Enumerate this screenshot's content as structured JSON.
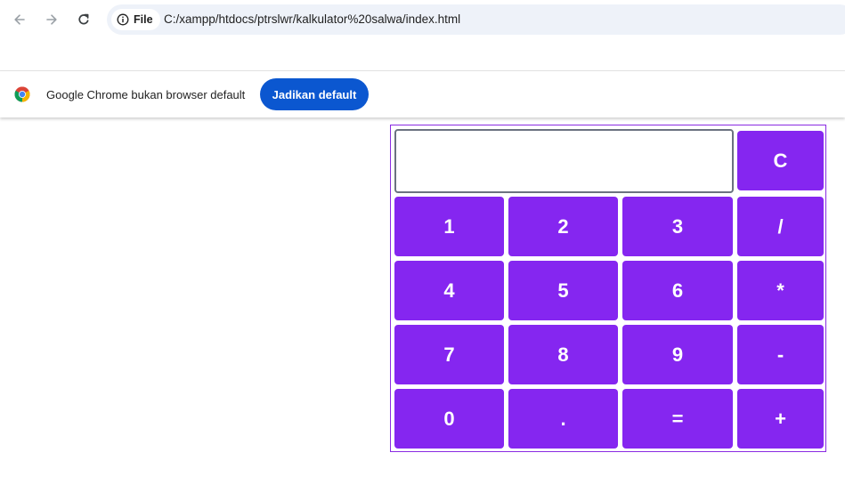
{
  "browser": {
    "chip_label": "File",
    "url": "C:/xampp/htdocs/ptrslwr/kalkulator%20salwa/index.html"
  },
  "infobar": {
    "message": "Google Chrome bukan browser default",
    "button_label": "Jadikan default"
  },
  "calculator": {
    "display_value": "",
    "clear_label": "C",
    "rows": [
      [
        "1",
        "2",
        "3",
        "/"
      ],
      [
        "4",
        "5",
        "6",
        "*"
      ],
      [
        "7",
        "8",
        "9",
        "-"
      ],
      [
        "0",
        ".",
        "=",
        "+"
      ]
    ]
  },
  "colors": {
    "key_background": "#8526f0",
    "key_text": "#ffffff",
    "infobar_button": "#0b57d0"
  }
}
